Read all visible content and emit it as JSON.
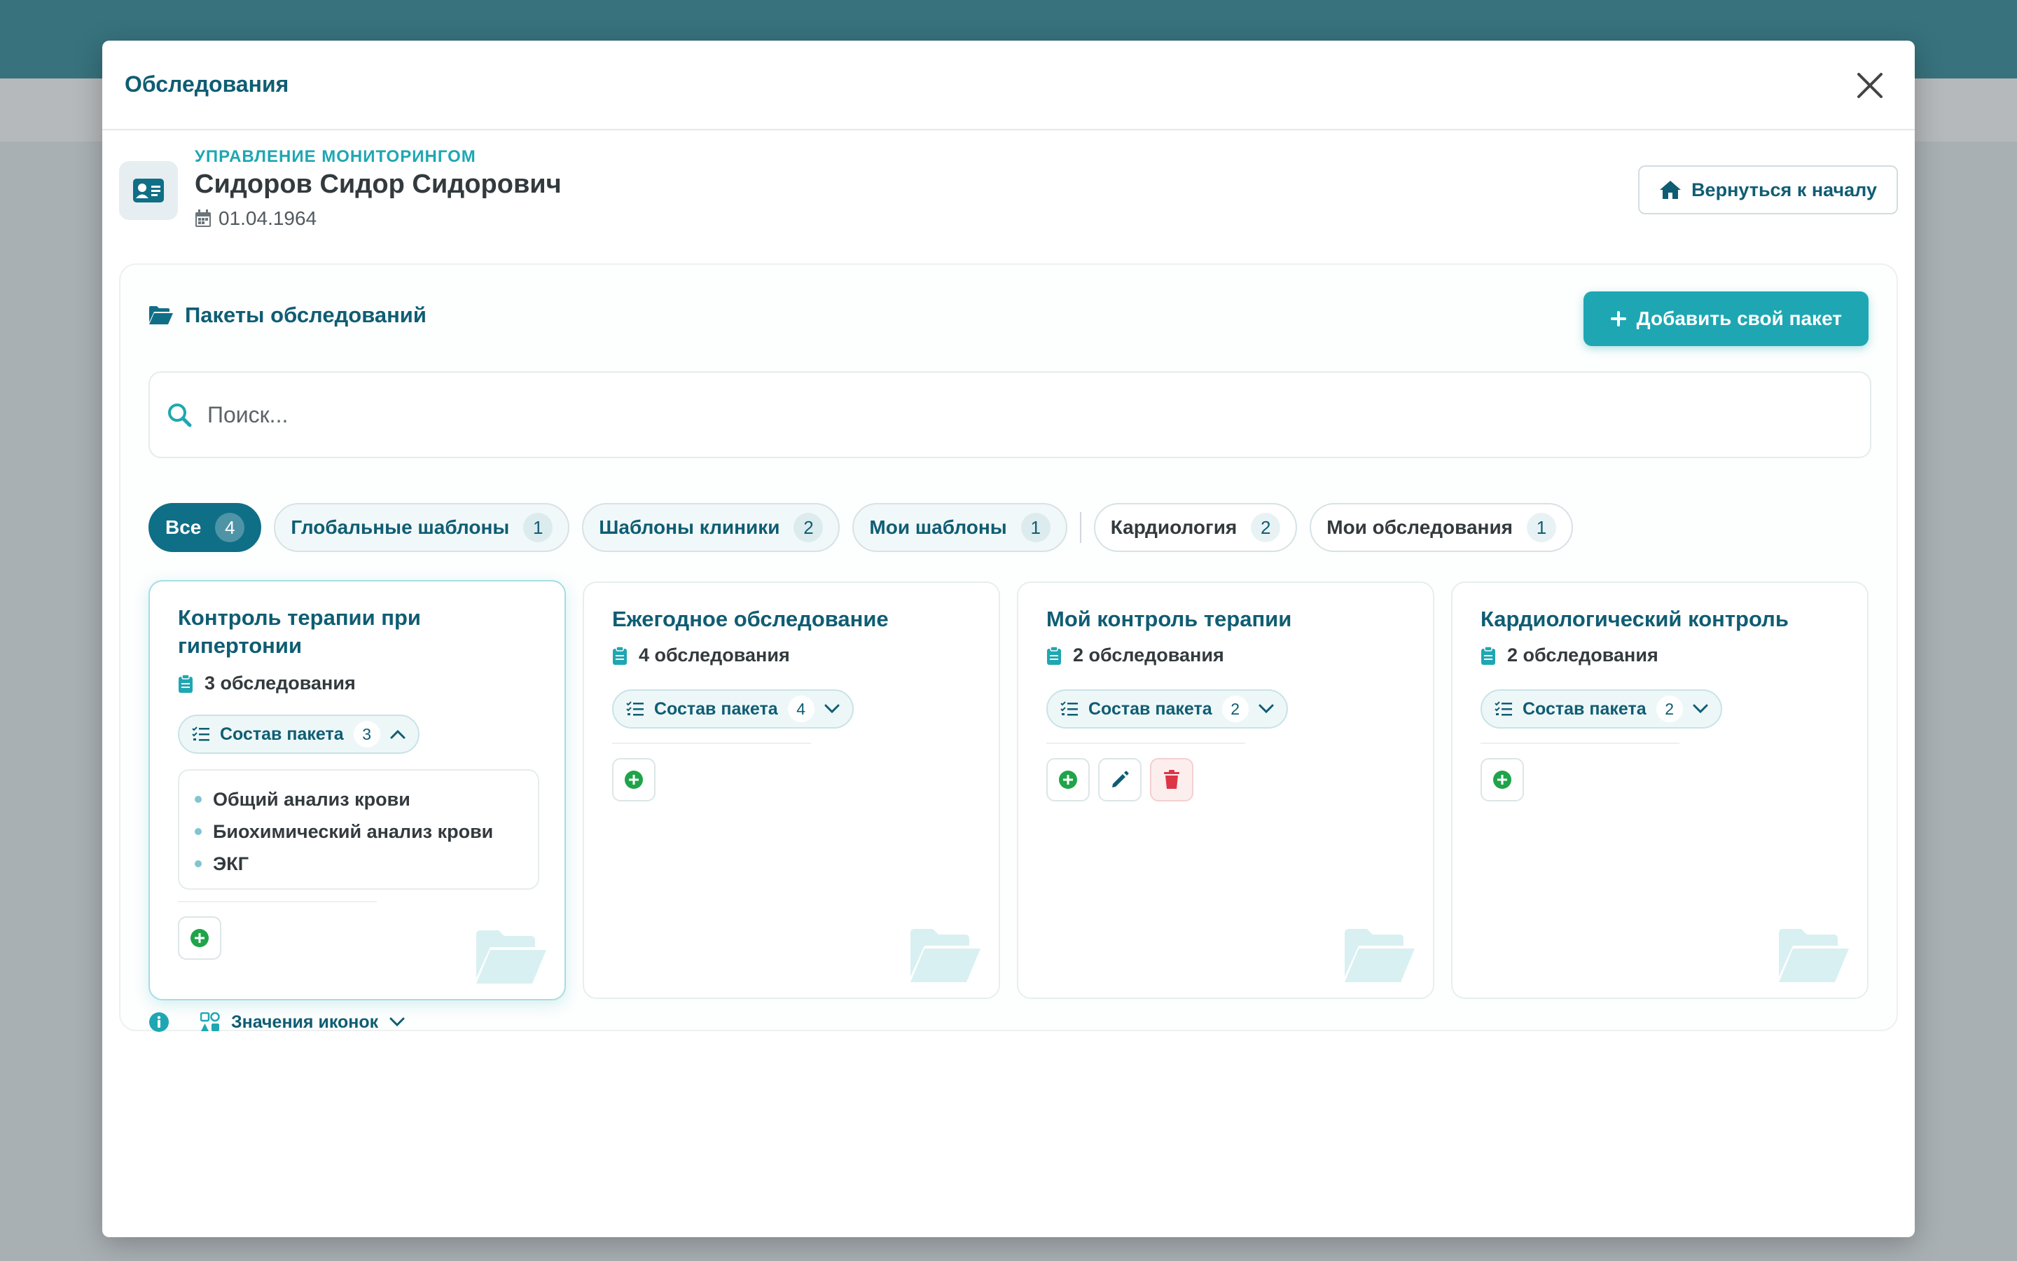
{
  "modal": {
    "title": "Обследования"
  },
  "patient": {
    "section_label": "УПРАВЛЕНИЕ МОНИТОРИНГОМ",
    "name": "Сидоров Сидор Сидорович",
    "dob": "01.04.1964",
    "home_button": "Вернуться к началу"
  },
  "packages": {
    "title": "Пакеты обследований",
    "add_button": "Добавить свой пакет",
    "search_placeholder": "Поиск...",
    "filters": [
      {
        "label": "Все",
        "count": "4"
      },
      {
        "label": "Глобальные шаблоны",
        "count": "1"
      },
      {
        "label": "Шаблоны клиники",
        "count": "2"
      },
      {
        "label": "Мои шаблоны",
        "count": "1"
      },
      {
        "label": "Кардиология",
        "count": "2"
      },
      {
        "label": "Мои обследования",
        "count": "1"
      }
    ],
    "cards": [
      {
        "title": "Контроль терапии при гипертонии",
        "exams": "3 обследования",
        "composition_label": "Состав пакета",
        "composition_count": "3",
        "items": [
          "Общий анализ крови",
          "Биохимический анализ крови",
          "ЭКГ"
        ]
      },
      {
        "title": "Ежегодное обследование",
        "exams": "4 обследования",
        "composition_label": "Состав пакета",
        "composition_count": "4"
      },
      {
        "title": "Мой контроль терапии",
        "exams": "2 обследования",
        "composition_label": "Состав пакета",
        "composition_count": "2"
      },
      {
        "title": "Кардиологический контроль",
        "exams": "2 обследования",
        "composition_label": "Состав пакета",
        "composition_count": "2"
      }
    ],
    "legend_label": "Значения иконок"
  },
  "colors": {
    "primary": "#0f5d73",
    "accent": "#1ea7b3",
    "add_green": "#1fa44a",
    "delete_red": "#dc3545"
  }
}
